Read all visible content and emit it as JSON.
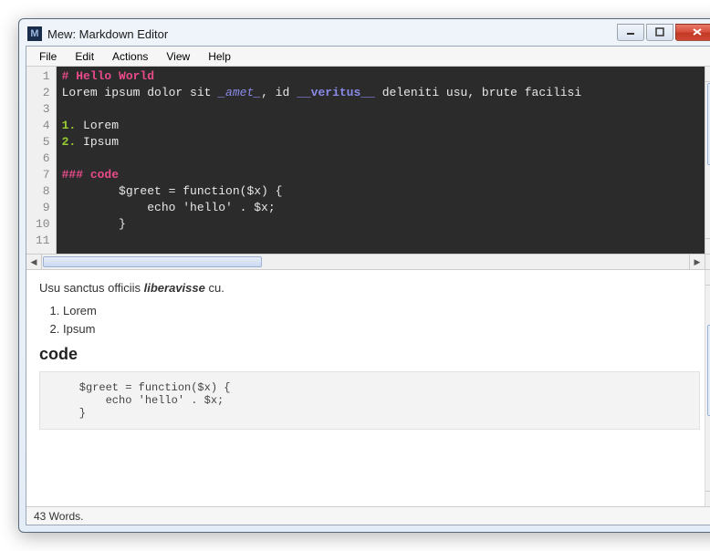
{
  "window": {
    "title": "Mew: Markdown Editor",
    "app_icon_letter": "M"
  },
  "menu": {
    "file": "File",
    "edit": "Edit",
    "actions": "Actions",
    "view": "View",
    "help": "Help"
  },
  "editor": {
    "line_count": 11,
    "lines": [
      {
        "n": 1,
        "tokens": [
          {
            "t": "# Hello World",
            "c": "tk-head"
          }
        ]
      },
      {
        "n": 2,
        "tokens": [
          {
            "t": "Lorem ipsum dolor sit ",
            "c": ""
          },
          {
            "t": "_amet_",
            "c": "tk-em"
          },
          {
            "t": ", id ",
            "c": ""
          },
          {
            "t": "__veritus__",
            "c": "tk-strong"
          },
          {
            "t": " deleniti usu, brute facilisi",
            "c": ""
          }
        ]
      },
      {
        "n": 3,
        "tokens": []
      },
      {
        "n": 4,
        "tokens": [
          {
            "t": "1.",
            "c": "tk-num"
          },
          {
            "t": " Lorem",
            "c": ""
          }
        ]
      },
      {
        "n": 5,
        "tokens": [
          {
            "t": "2.",
            "c": "tk-num"
          },
          {
            "t": " Ipsum",
            "c": ""
          }
        ]
      },
      {
        "n": 6,
        "tokens": []
      },
      {
        "n": 7,
        "tokens": [
          {
            "t": "### code",
            "c": "tk-head"
          }
        ]
      },
      {
        "n": 8,
        "tokens": [
          {
            "t": "        $greet = function($x) {",
            "c": ""
          }
        ]
      },
      {
        "n": 9,
        "tokens": [
          {
            "t": "            echo 'hello' . $x;",
            "c": ""
          }
        ]
      },
      {
        "n": 10,
        "tokens": [
          {
            "t": "        }",
            "c": ""
          }
        ]
      },
      {
        "n": 11,
        "tokens": []
      }
    ]
  },
  "preview": {
    "p1_pre": "Usu sanctus officiis ",
    "p1_em": "liberavisse",
    "p1_post": " cu.",
    "list": [
      "Lorem",
      "Ipsum"
    ],
    "h3": "code",
    "codeblock": "    $greet = function($x) {\n        echo 'hello' . $x;\n    }"
  },
  "status": {
    "words": "43 Words."
  }
}
